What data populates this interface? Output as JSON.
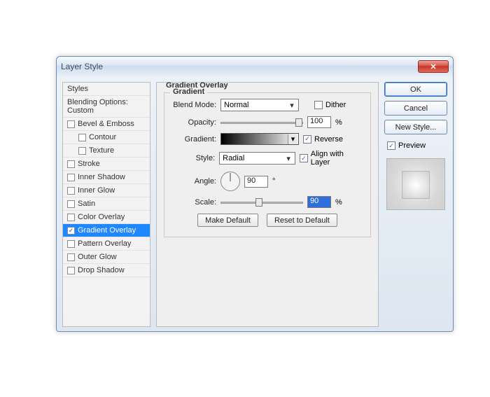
{
  "window": {
    "title": "Layer Style",
    "close_glyph": "✕"
  },
  "sidebar": {
    "header": "Styles",
    "blending": "Blending Options: Custom",
    "items": [
      {
        "label": "Bevel & Emboss",
        "checked": false
      },
      {
        "label": "Contour",
        "checked": false,
        "indent": true
      },
      {
        "label": "Texture",
        "checked": false,
        "indent": true
      },
      {
        "label": "Stroke",
        "checked": false
      },
      {
        "label": "Inner Shadow",
        "checked": false
      },
      {
        "label": "Inner Glow",
        "checked": false
      },
      {
        "label": "Satin",
        "checked": false
      },
      {
        "label": "Color Overlay",
        "checked": false
      },
      {
        "label": "Gradient Overlay",
        "checked": true,
        "selected": true
      },
      {
        "label": "Pattern Overlay",
        "checked": false
      },
      {
        "label": "Outer Glow",
        "checked": false
      },
      {
        "label": "Drop Shadow",
        "checked": false
      }
    ]
  },
  "panel": {
    "title": "Gradient Overlay",
    "group": "Gradient",
    "labels": {
      "blend_mode": "Blend Mode:",
      "opacity": "Opacity:",
      "gradient": "Gradient:",
      "style": "Style:",
      "angle": "Angle:",
      "scale": "Scale:"
    },
    "values": {
      "blend_mode": "Normal",
      "opacity": "100",
      "opacity_unit": "%",
      "reverse_label": "Reverse",
      "reverse_checked": true,
      "dither_label": "Dither",
      "dither_checked": false,
      "style": "Radial",
      "align_label": "Align with Layer",
      "align_checked": true,
      "angle": "90",
      "angle_unit": "°",
      "scale": "90",
      "scale_unit": "%"
    },
    "buttons": {
      "make_default": "Make Default",
      "reset_default": "Reset to Default"
    }
  },
  "actions": {
    "ok": "OK",
    "cancel": "Cancel",
    "new_style": "New Style...",
    "preview": "Preview",
    "preview_checked": true
  },
  "icons": {
    "check": "✓",
    "dropdown": "▾"
  }
}
